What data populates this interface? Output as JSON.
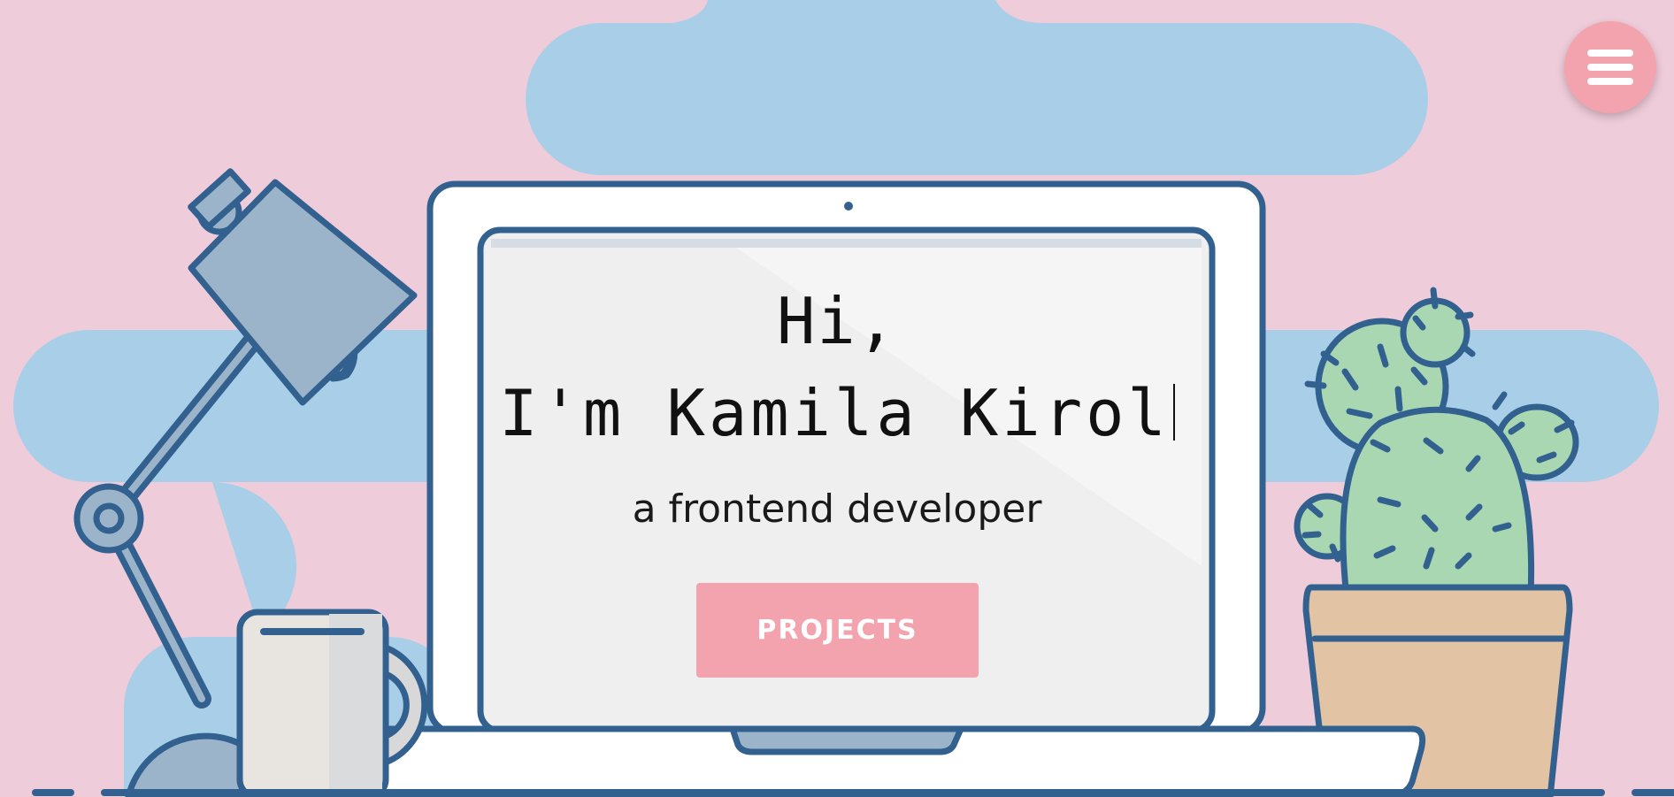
{
  "hero": {
    "greeting_line1": "Hi,",
    "greeting_line2": "I'm Kamila Kirol",
    "subtitle": "a frontend developer",
    "cta_label": "PROJECTS"
  },
  "menu": {
    "icon": "hamburger-menu-icon"
  },
  "colors": {
    "background": "#efccd9",
    "cloud": "#a8cfe7",
    "outline": "#33618f",
    "accent": "#f2a3ad",
    "screen": "#efefef",
    "cactus": "#a8d7b2",
    "pot": "#e2c3a4",
    "lamp": "#9cb4c9",
    "mug": "#e8e4df"
  }
}
